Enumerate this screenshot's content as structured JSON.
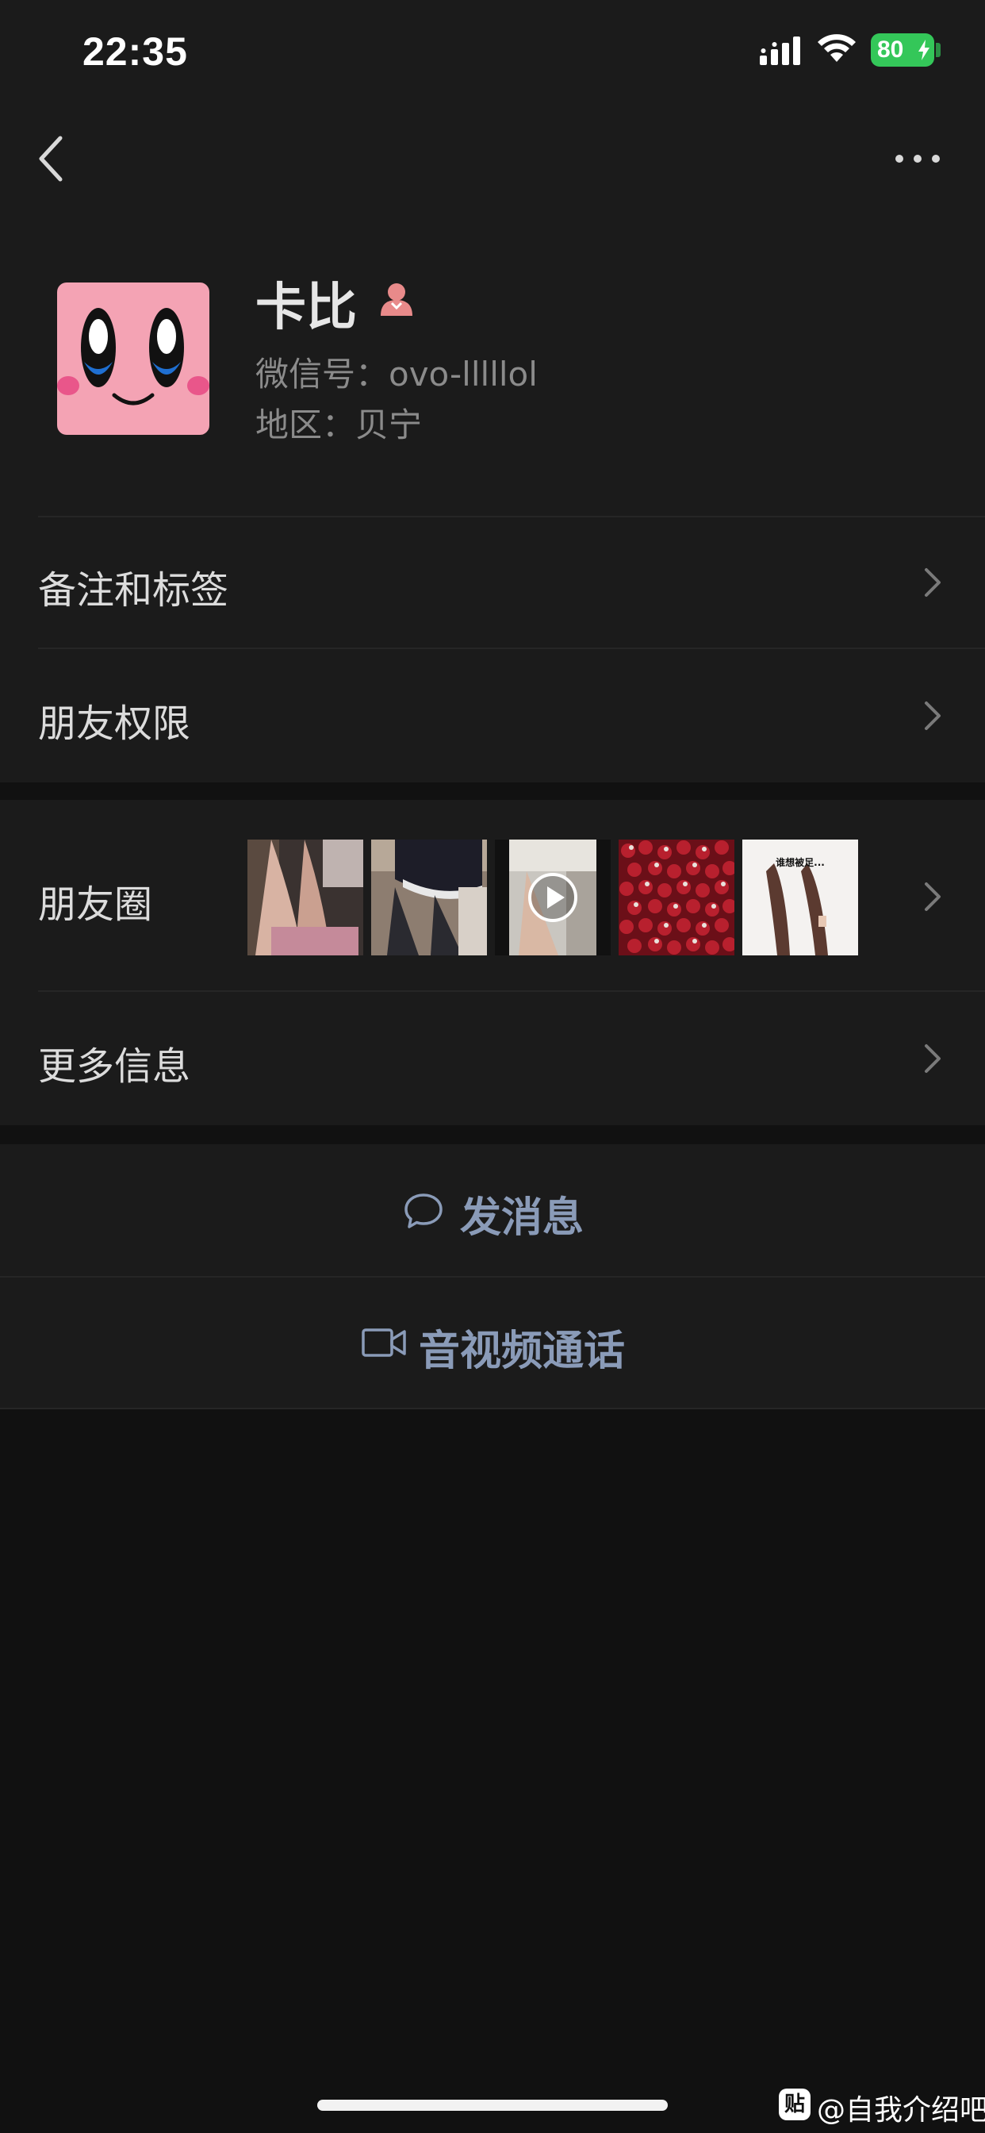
{
  "status_bar": {
    "time": "22:35",
    "battery": "80"
  },
  "profile": {
    "name": "卡比",
    "wechat_id": "微信号：ovo-lllllol",
    "region": "地区：贝宁"
  },
  "rows": {
    "remark_tags": "备注和标签",
    "friend_permissions": "朋友权限",
    "moments": "朋友圈",
    "more_info": "更多信息"
  },
  "moments_thumbs": [
    {
      "caption": ""
    },
    {
      "caption": ""
    },
    {
      "caption": ""
    },
    {
      "caption": ""
    },
    {
      "caption": "谁想被足..."
    }
  ],
  "actions": {
    "send_message": "发消息",
    "video_call": "音视频通话"
  },
  "watermark": {
    "badge": "贴",
    "text": "@自我介绍吧"
  },
  "colors": {
    "background": "#111111",
    "panel": "#1b1b1b",
    "link": "#8a9bb8",
    "battery": "#34c759",
    "avatar_bg": "#f4a3b4"
  },
  "icons": [
    "signal-icon",
    "wifi-icon",
    "battery-bolt-icon",
    "back-icon",
    "more-icon",
    "female-icon",
    "chevron-right-icon",
    "chat-bubble-icon",
    "video-camera-icon",
    "play-icon"
  ]
}
